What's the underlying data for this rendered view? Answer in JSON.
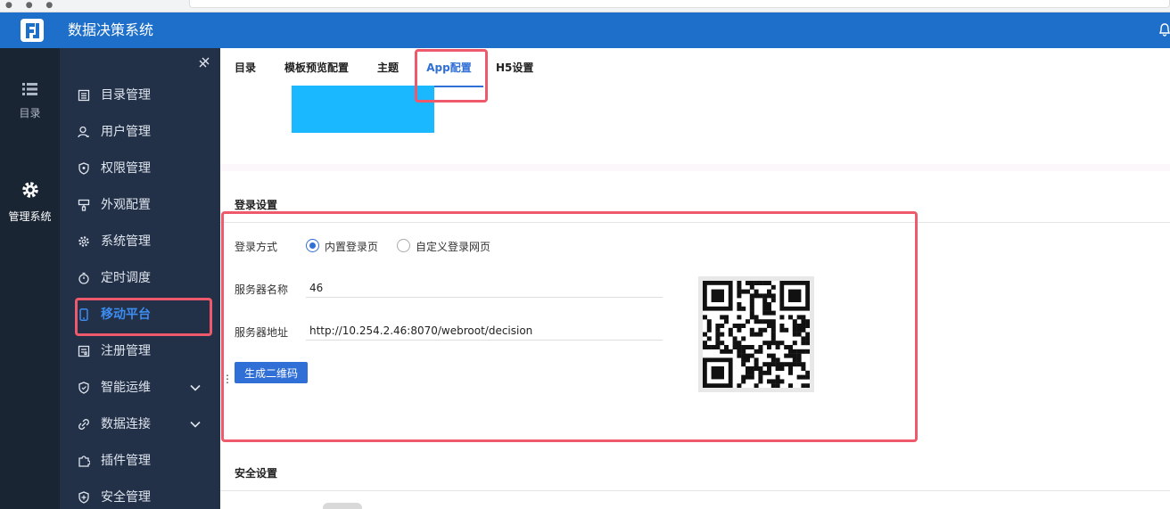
{
  "app": {
    "title": "数据决策系统"
  },
  "rail": [
    {
      "label": "目录",
      "icon": "list-icon"
    },
    {
      "label": "管理系统",
      "icon": "gear-icon"
    }
  ],
  "sidebar": {
    "items": [
      {
        "label": "目录管理",
        "icon": "catalog-icon"
      },
      {
        "label": "用户管理",
        "icon": "user-icon"
      },
      {
        "label": "权限管理",
        "icon": "shield-icon"
      },
      {
        "label": "外观配置",
        "icon": "brush-icon"
      },
      {
        "label": "系统管理",
        "icon": "gear-icon"
      },
      {
        "label": "定时调度",
        "icon": "timer-icon"
      },
      {
        "label": "移动平台",
        "icon": "mobile-icon",
        "active": true
      },
      {
        "label": "注册管理",
        "icon": "register-icon"
      },
      {
        "label": "智能运维",
        "icon": "ops-icon",
        "expandable": true
      },
      {
        "label": "数据连接",
        "icon": "link-icon",
        "expandable": true
      },
      {
        "label": "插件管理",
        "icon": "plugin-icon"
      },
      {
        "label": "安全管理",
        "icon": "security-icon"
      }
    ]
  },
  "tabs": [
    {
      "label": "目录"
    },
    {
      "label": "模板预览配置"
    },
    {
      "label": "主题"
    },
    {
      "label": "App配置",
      "active": true
    },
    {
      "label": "H5设置"
    }
  ],
  "login_settings": {
    "title": "登录设置",
    "login_method_label": "登录方式",
    "options": [
      {
        "label": "内置登录页",
        "checked": true
      },
      {
        "label": "自定义登录网页",
        "checked": false
      }
    ],
    "server_name_label": "服务器名称",
    "server_name_value": "46",
    "server_address_label": "服务器地址",
    "server_address_value": "http://10.254.2.46:8070/webroot/decision",
    "generate_button": "生成二维码"
  },
  "security_settings": {
    "title": "安全设置"
  },
  "colors": {
    "topbar": "#1e6fc9",
    "rail": "#1a2534",
    "sidebar": "#223048",
    "accent": "#2f6fd6",
    "highlight": "#ee5a6b",
    "banner": "#1ab8ff"
  }
}
